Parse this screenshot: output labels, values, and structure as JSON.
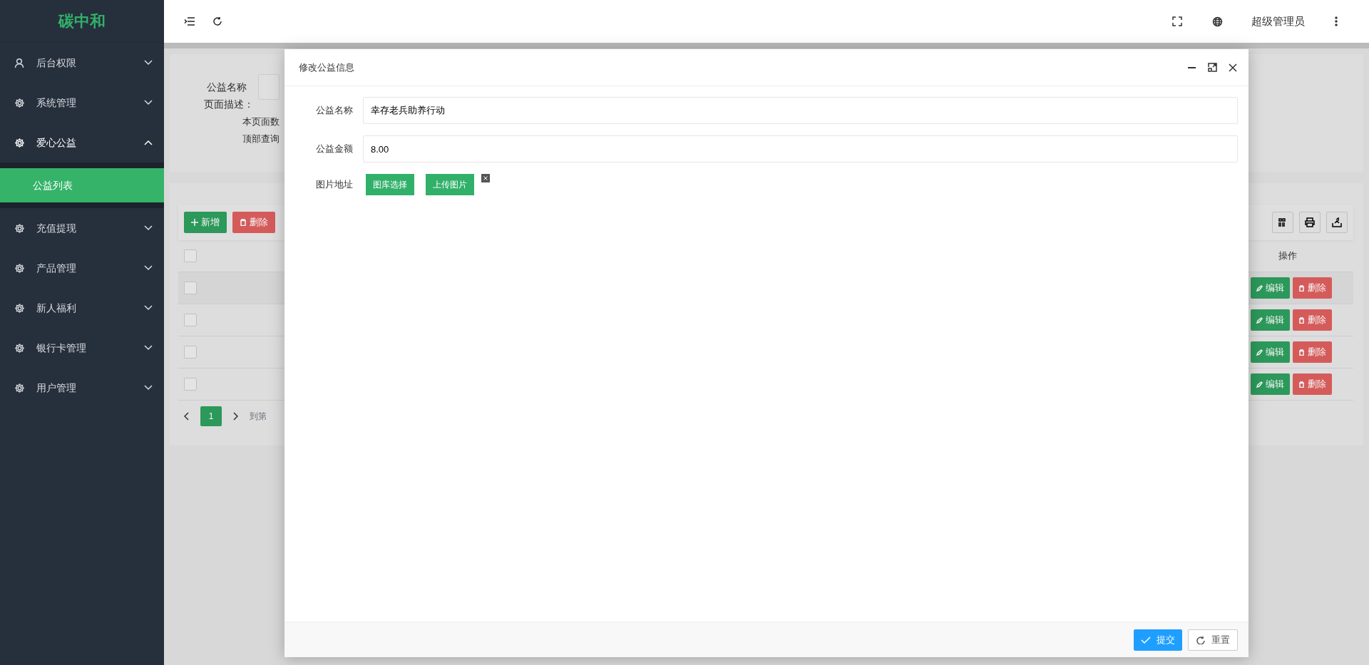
{
  "sidebar": {
    "logo": "碳中和",
    "items": [
      {
        "label": "后台权限",
        "kind": "user",
        "expanded": false
      },
      {
        "label": "系统管理",
        "kind": "gear",
        "expanded": false
      },
      {
        "label": "爱心公益",
        "kind": "gear",
        "expanded": true,
        "children": [
          {
            "label": "公益列表",
            "selected": true
          }
        ]
      },
      {
        "label": "充值提现",
        "kind": "gear",
        "expanded": false
      },
      {
        "label": "产品管理",
        "kind": "gear",
        "expanded": false
      },
      {
        "label": "新人福利",
        "kind": "gear",
        "expanded": false
      },
      {
        "label": "银行卡管理",
        "kind": "gear",
        "expanded": false
      },
      {
        "label": "用户管理",
        "kind": "gear",
        "expanded": false
      }
    ]
  },
  "topbar": {
    "user": "超级管理员"
  },
  "search_panel": {
    "field_label": "公益名称",
    "description_title": "页面描述：",
    "description_lines": [
      "本页面数",
      "顶部查询"
    ]
  },
  "toolbar": {
    "buttons": [
      {
        "label": "新增",
        "kind": "add"
      },
      {
        "label": "删除",
        "kind": "delete"
      }
    ]
  },
  "table": {
    "select_all_checked": false,
    "columns": [
      "操作"
    ],
    "rows": [
      {
        "checked": false,
        "actions": [
          "编辑",
          "删除"
        ]
      },
      {
        "checked": false,
        "actions": [
          "编辑",
          "删除"
        ]
      },
      {
        "checked": false,
        "actions": [
          "编辑",
          "删除"
        ]
      },
      {
        "checked": false,
        "actions": [
          "编辑",
          "删除"
        ]
      }
    ]
  },
  "pagination": {
    "pages": [
      {
        "label": "1",
        "selected": true
      }
    ],
    "goto_label": "到第"
  },
  "dialog": {
    "title": "修改公益信息",
    "fields": [
      {
        "label": "公益名称",
        "kind": "text",
        "value": "幸存老兵助养行动"
      },
      {
        "label": "公益金额",
        "kind": "text",
        "value": "8.00"
      },
      {
        "label": "图片地址",
        "kind": "image",
        "buttons": [
          "图库选择",
          "上传图片"
        ]
      }
    ],
    "footer_buttons": [
      {
        "label": "提交",
        "kind": "submit"
      },
      {
        "label": "重置",
        "kind": "reset"
      }
    ]
  }
}
